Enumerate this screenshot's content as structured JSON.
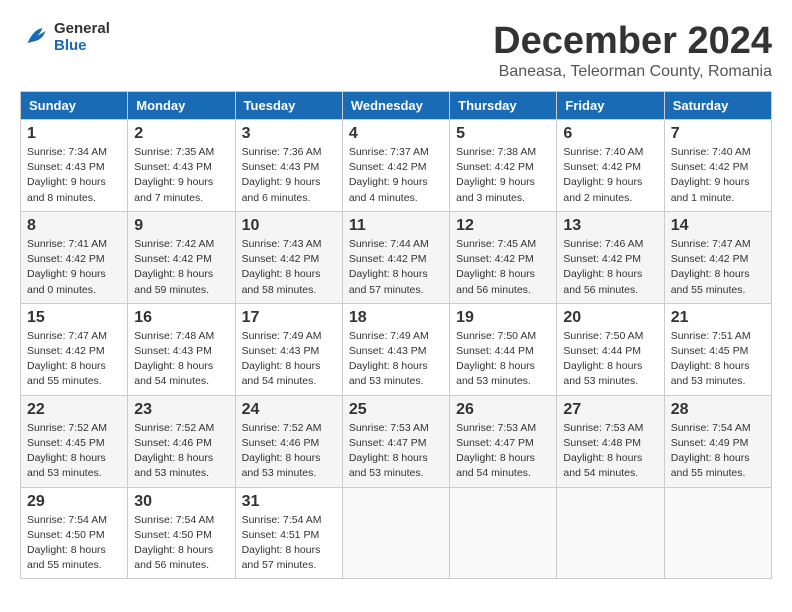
{
  "logo": {
    "line1": "General",
    "line2": "Blue"
  },
  "title": "December 2024",
  "subtitle": "Baneasa, Teleorman County, Romania",
  "weekdays": [
    "Sunday",
    "Monday",
    "Tuesday",
    "Wednesday",
    "Thursday",
    "Friday",
    "Saturday"
  ],
  "weeks": [
    [
      {
        "day": "1",
        "info": "Sunrise: 7:34 AM\nSunset: 4:43 PM\nDaylight: 9 hours\nand 8 minutes."
      },
      {
        "day": "2",
        "info": "Sunrise: 7:35 AM\nSunset: 4:43 PM\nDaylight: 9 hours\nand 7 minutes."
      },
      {
        "day": "3",
        "info": "Sunrise: 7:36 AM\nSunset: 4:43 PM\nDaylight: 9 hours\nand 6 minutes."
      },
      {
        "day": "4",
        "info": "Sunrise: 7:37 AM\nSunset: 4:42 PM\nDaylight: 9 hours\nand 4 minutes."
      },
      {
        "day": "5",
        "info": "Sunrise: 7:38 AM\nSunset: 4:42 PM\nDaylight: 9 hours\nand 3 minutes."
      },
      {
        "day": "6",
        "info": "Sunrise: 7:40 AM\nSunset: 4:42 PM\nDaylight: 9 hours\nand 2 minutes."
      },
      {
        "day": "7",
        "info": "Sunrise: 7:40 AM\nSunset: 4:42 PM\nDaylight: 9 hours\nand 1 minute."
      }
    ],
    [
      {
        "day": "8",
        "info": "Sunrise: 7:41 AM\nSunset: 4:42 PM\nDaylight: 9 hours\nand 0 minutes."
      },
      {
        "day": "9",
        "info": "Sunrise: 7:42 AM\nSunset: 4:42 PM\nDaylight: 8 hours\nand 59 minutes."
      },
      {
        "day": "10",
        "info": "Sunrise: 7:43 AM\nSunset: 4:42 PM\nDaylight: 8 hours\nand 58 minutes."
      },
      {
        "day": "11",
        "info": "Sunrise: 7:44 AM\nSunset: 4:42 PM\nDaylight: 8 hours\nand 57 minutes."
      },
      {
        "day": "12",
        "info": "Sunrise: 7:45 AM\nSunset: 4:42 PM\nDaylight: 8 hours\nand 56 minutes."
      },
      {
        "day": "13",
        "info": "Sunrise: 7:46 AM\nSunset: 4:42 PM\nDaylight: 8 hours\nand 56 minutes."
      },
      {
        "day": "14",
        "info": "Sunrise: 7:47 AM\nSunset: 4:42 PM\nDaylight: 8 hours\nand 55 minutes."
      }
    ],
    [
      {
        "day": "15",
        "info": "Sunrise: 7:47 AM\nSunset: 4:42 PM\nDaylight: 8 hours\nand 55 minutes."
      },
      {
        "day": "16",
        "info": "Sunrise: 7:48 AM\nSunset: 4:43 PM\nDaylight: 8 hours\nand 54 minutes."
      },
      {
        "day": "17",
        "info": "Sunrise: 7:49 AM\nSunset: 4:43 PM\nDaylight: 8 hours\nand 54 minutes."
      },
      {
        "day": "18",
        "info": "Sunrise: 7:49 AM\nSunset: 4:43 PM\nDaylight: 8 hours\nand 53 minutes."
      },
      {
        "day": "19",
        "info": "Sunrise: 7:50 AM\nSunset: 4:44 PM\nDaylight: 8 hours\nand 53 minutes."
      },
      {
        "day": "20",
        "info": "Sunrise: 7:50 AM\nSunset: 4:44 PM\nDaylight: 8 hours\nand 53 minutes."
      },
      {
        "day": "21",
        "info": "Sunrise: 7:51 AM\nSunset: 4:45 PM\nDaylight: 8 hours\nand 53 minutes."
      }
    ],
    [
      {
        "day": "22",
        "info": "Sunrise: 7:52 AM\nSunset: 4:45 PM\nDaylight: 8 hours\nand 53 minutes."
      },
      {
        "day": "23",
        "info": "Sunrise: 7:52 AM\nSunset: 4:46 PM\nDaylight: 8 hours\nand 53 minutes."
      },
      {
        "day": "24",
        "info": "Sunrise: 7:52 AM\nSunset: 4:46 PM\nDaylight: 8 hours\nand 53 minutes."
      },
      {
        "day": "25",
        "info": "Sunrise: 7:53 AM\nSunset: 4:47 PM\nDaylight: 8 hours\nand 53 minutes."
      },
      {
        "day": "26",
        "info": "Sunrise: 7:53 AM\nSunset: 4:47 PM\nDaylight: 8 hours\nand 54 minutes."
      },
      {
        "day": "27",
        "info": "Sunrise: 7:53 AM\nSunset: 4:48 PM\nDaylight: 8 hours\nand 54 minutes."
      },
      {
        "day": "28",
        "info": "Sunrise: 7:54 AM\nSunset: 4:49 PM\nDaylight: 8 hours\nand 55 minutes."
      }
    ],
    [
      {
        "day": "29",
        "info": "Sunrise: 7:54 AM\nSunset: 4:50 PM\nDaylight: 8 hours\nand 55 minutes."
      },
      {
        "day": "30",
        "info": "Sunrise: 7:54 AM\nSunset: 4:50 PM\nDaylight: 8 hours\nand 56 minutes."
      },
      {
        "day": "31",
        "info": "Sunrise: 7:54 AM\nSunset: 4:51 PM\nDaylight: 8 hours\nand 57 minutes."
      },
      {
        "day": "",
        "info": ""
      },
      {
        "day": "",
        "info": ""
      },
      {
        "day": "",
        "info": ""
      },
      {
        "day": "",
        "info": ""
      }
    ]
  ]
}
